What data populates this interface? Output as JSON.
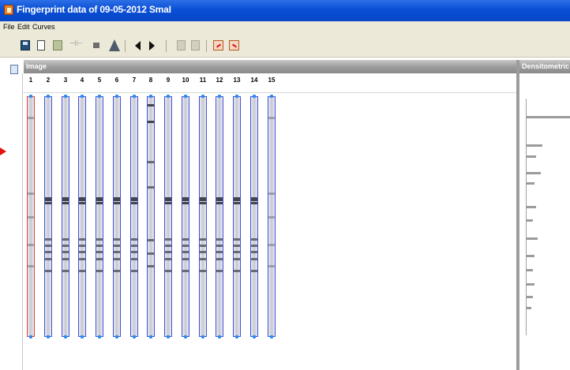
{
  "window": {
    "title": "Fingerprint data of 09-05-2012 SmaI"
  },
  "menu": {
    "items": [
      "File",
      "Edit",
      "Curves"
    ]
  },
  "panels": {
    "image_title": "Image",
    "densitometric_title": "Densitometric"
  },
  "lanes": {
    "labels": [
      "1",
      "2",
      "3",
      "4",
      "5",
      "6",
      "7",
      "8",
      "9",
      "10",
      "11",
      "12",
      "13",
      "14",
      "15"
    ]
  },
  "colors": {
    "titlebar": "#0a4fd6",
    "lane_outline": "#3f4fd6",
    "reference_lane_outline": "#e2403c",
    "band": "#3b3d47",
    "marker_arrow": "#e2130b"
  }
}
